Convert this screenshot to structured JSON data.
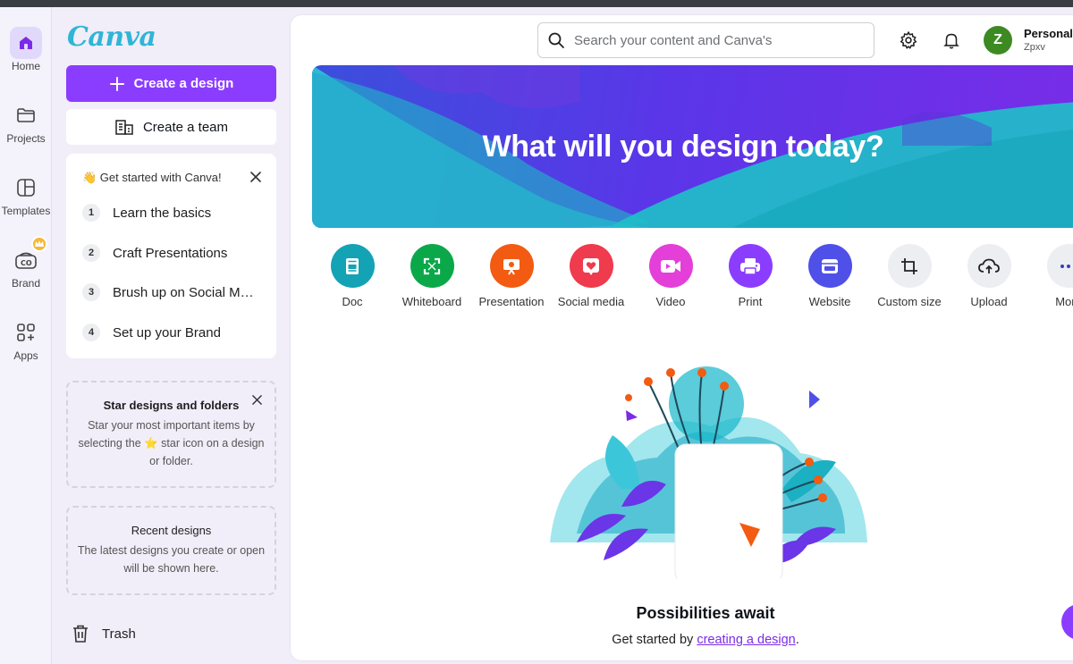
{
  "rail": {
    "items": [
      {
        "label": "Home"
      },
      {
        "label": "Projects"
      },
      {
        "label": "Templates"
      },
      {
        "label": "Brand"
      },
      {
        "label": "Apps"
      }
    ]
  },
  "sidebar": {
    "logo": "Canva",
    "create_design": "Create a design",
    "create_team": "Create a team",
    "get_started": {
      "title": "👋 Get started with Canva!",
      "items": [
        {
          "num": "1",
          "text": "Learn the basics"
        },
        {
          "num": "2",
          "text": "Craft Presentations"
        },
        {
          "num": "3",
          "text": "Brush up on Social Media"
        },
        {
          "num": "4",
          "text": "Set up your Brand"
        }
      ]
    },
    "star_card": {
      "title": "Star designs and folders",
      "body": "Star your most important items by selecting the ⭐ star icon on a design or folder."
    },
    "recent_card": {
      "title": "Recent designs",
      "body": "The latest designs you create or open will be shown here."
    },
    "trash": "Trash"
  },
  "header": {
    "search_placeholder": "Search your content and Canva's",
    "avatar_letter": "Z",
    "account_name": "Personal",
    "account_sub": "Zpxv"
  },
  "hero": {
    "title": "What will you design today?"
  },
  "design_types": [
    {
      "label": "Doc",
      "color": "#13a3b5",
      "icon": "doc-icon"
    },
    {
      "label": "Whiteboard",
      "color": "#0ba84a",
      "icon": "whiteboard-icon"
    },
    {
      "label": "Presentation",
      "color": "#f25b11",
      "icon": "presentation-icon"
    },
    {
      "label": "Social media",
      "color": "#f03a4d",
      "icon": "heart-icon"
    },
    {
      "label": "Video",
      "color": "#e43fd9",
      "icon": "video-icon"
    },
    {
      "label": "Print",
      "color": "#8b3dff",
      "icon": "printer-icon"
    },
    {
      "label": "Website",
      "color": "#4f50e8",
      "icon": "website-icon"
    },
    {
      "label": "Custom size",
      "color": "#eceef1",
      "icon": "crop-icon"
    },
    {
      "label": "Upload",
      "color": "#eceef1",
      "icon": "upload-cloud-icon"
    },
    {
      "label": "More",
      "color": "#eceef1",
      "icon": "more-icon"
    }
  ],
  "empty_state": {
    "title": "Possibilities await",
    "sub_prefix": "Get started by ",
    "sub_link": "creating a design",
    "sub_suffix": "."
  }
}
